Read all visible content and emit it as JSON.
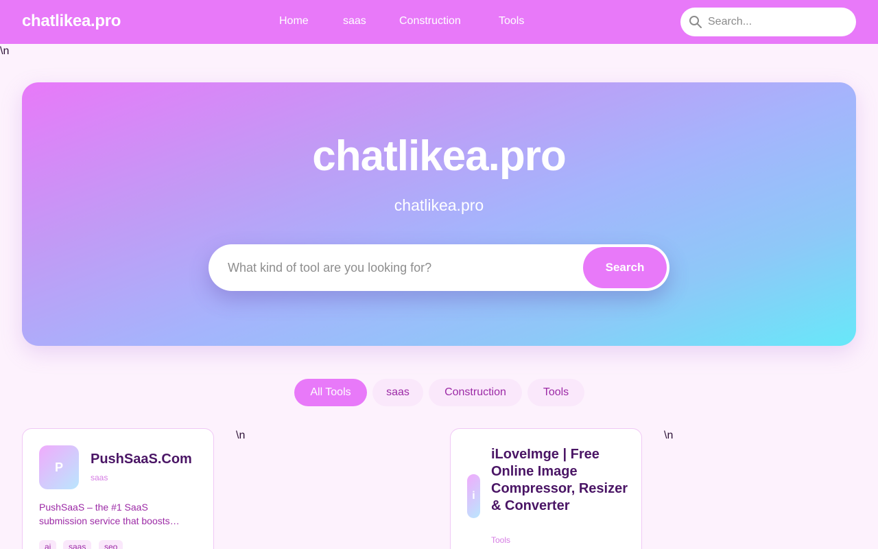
{
  "nav": {
    "logo": "chatlikea.pro",
    "links": [
      "Home",
      "saas",
      "Construction",
      "Tools"
    ],
    "search_placeholder": "Search..."
  },
  "stray_text": "\\n",
  "hero": {
    "title": "chatlikea.pro",
    "subtitle": "chatlikea.pro",
    "search_placeholder": "What kind of tool are you looking for?",
    "search_button": "Search"
  },
  "filters": [
    {
      "label": "All Tools",
      "active": true
    },
    {
      "label": "saas",
      "active": false
    },
    {
      "label": "Construction",
      "active": false
    },
    {
      "label": "Tools",
      "active": false
    }
  ],
  "cards": [
    {
      "initial": "P",
      "title": "PushSaaS.Com",
      "category": "saas",
      "description": "PushSaaS – the #1 SaaS submission service that boosts…",
      "tags": [
        "ai",
        "saas",
        "seo"
      ]
    },
    {
      "initial": "i",
      "title": "iLoveImge | Free Online Image Compressor, Resizer & Converter",
      "category": "Tools"
    }
  ],
  "colors": {
    "nav_bg": "#e879f9",
    "accent": "#e879f9",
    "page_bg": "#fdf2fd",
    "pill_bg": "#fae8fb",
    "pill_text": "#9c2aa6",
    "hero_gradient_start": "#e879f9",
    "hero_gradient_end": "#67e8f9"
  },
  "icons": {
    "nav_search": "search-icon"
  }
}
